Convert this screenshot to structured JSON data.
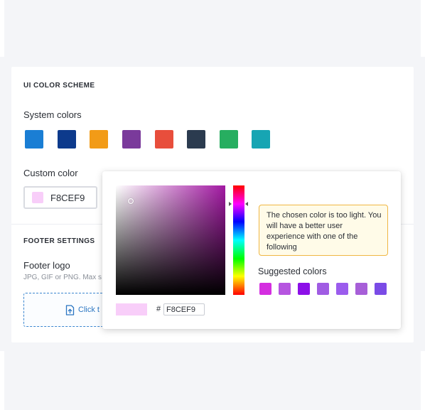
{
  "ui_color_scheme": {
    "title": "UI COLOR SCHEME",
    "system_colors_label": "System colors",
    "system_colors": [
      "#1a7ed4",
      "#0d3a8c",
      "#f29b17",
      "#7a3a9b",
      "#e84e3c",
      "#2b3b4f",
      "#27ae60",
      "#17a5b3"
    ],
    "custom_color_label": "Custom color",
    "custom_color_value": "F8CEF9",
    "custom_color_hex": "#f8cef9"
  },
  "footer_settings": {
    "title": "FOOTER SETTINGS",
    "footer_logo_label": "Footer logo",
    "hint": "JPG, GIF or PNG. Max s",
    "upload_text": "Click t",
    "upload_icon": "upload-file-icon"
  },
  "color_picker": {
    "hue_color": "#a319a3",
    "preview_color": "#f8cef9",
    "hash_symbol": "#",
    "hex_value": "F8CEF9",
    "warning_text": "The chosen color is too light. You will have a better user experience with one of the following",
    "suggested_label": "Suggested colors",
    "suggested_colors": [
      "#d42ee0",
      "#b655e0",
      "#8c0fe8",
      "#a05ce3",
      "#9b5ced",
      "#a75fd8",
      "#7a4be6"
    ]
  }
}
